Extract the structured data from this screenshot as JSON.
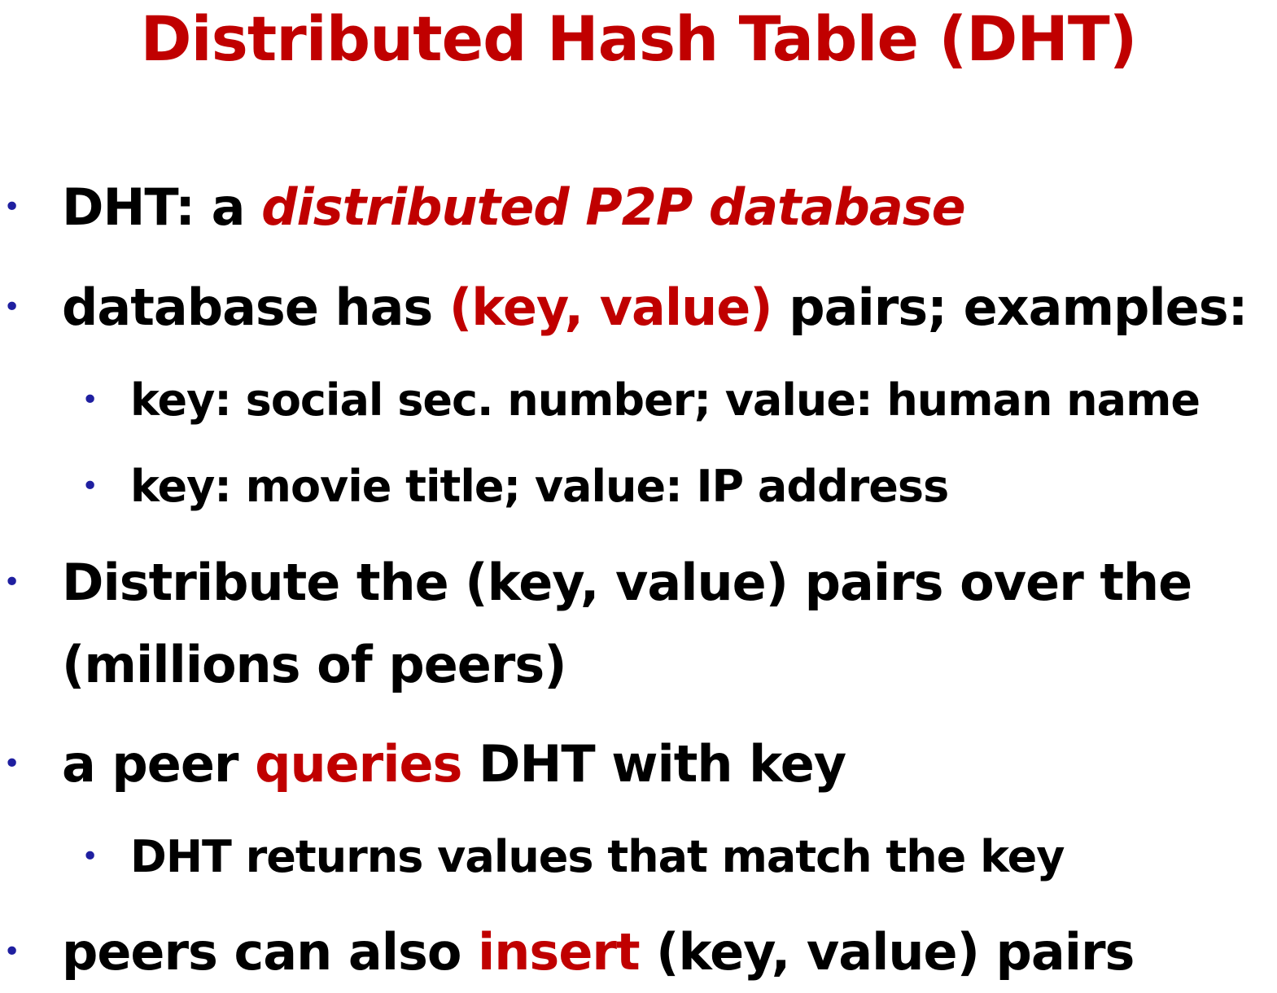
{
  "title": "Distributed Hash Table (DHT)",
  "bullets": [
    {
      "level": 1,
      "parts": [
        {
          "text": "DHT: a ",
          "style": "normal"
        },
        {
          "text": "distributed P2P database",
          "style": "red-italic"
        }
      ]
    },
    {
      "level": 1,
      "parts": [
        {
          "text": "database has ",
          "style": "normal"
        },
        {
          "text": "(key, value)",
          "style": "red"
        },
        {
          "text": " pairs; examples:",
          "style": "normal"
        }
      ]
    },
    {
      "level": 2,
      "parts": [
        {
          "text": "key: social sec. number; value: human name",
          "style": "normal"
        }
      ]
    },
    {
      "level": 2,
      "parts": [
        {
          "text": "key: movie title; value: IP address",
          "style": "normal"
        }
      ]
    },
    {
      "level": 1,
      "parts": [
        {
          "text": "Distribute the (key, value) pairs over the",
          "style": "normal"
        }
      ]
    },
    {
      "level": 1,
      "parts": [
        {
          "text": "(millions of peers)",
          "style": "normal"
        }
      ]
    },
    {
      "level": 1,
      "parts": [
        {
          "text": "a peer ",
          "style": "normal"
        },
        {
          "text": "queries",
          "style": "red"
        },
        {
          "text": " DHT with key",
          "style": "normal"
        }
      ]
    },
    {
      "level": 2,
      "parts": [
        {
          "text": "DHT returns values that match the key",
          "style": "normal"
        }
      ]
    },
    {
      "level": 1,
      "parts": [
        {
          "text": "peers can also ",
          "style": "normal"
        },
        {
          "text": "insert",
          "style": "red"
        },
        {
          "text": " (key, value) pairs",
          "style": "normal"
        }
      ]
    }
  ],
  "bullet_glyph": "•",
  "colors": {
    "accent": "#c00000",
    "bullet": "#1f1fa0",
    "text": "#000000"
  }
}
